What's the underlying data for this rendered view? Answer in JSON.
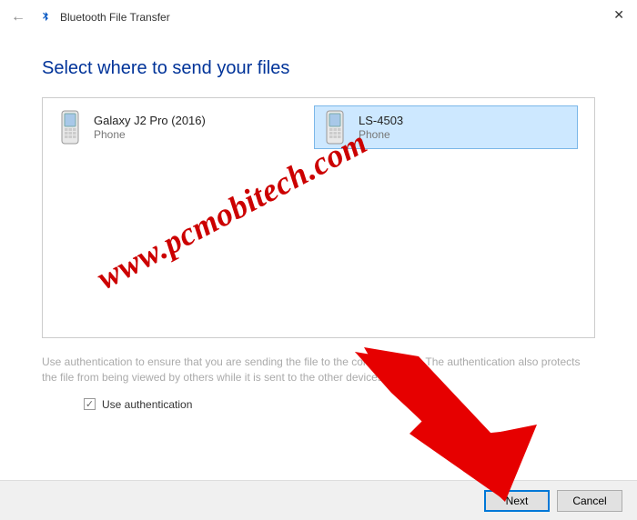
{
  "window": {
    "title": "Bluetooth File Transfer"
  },
  "heading": "Select where to send your files",
  "devices": [
    {
      "name": "Galaxy J2 Pro (2016)",
      "type": "Phone",
      "selected": false
    },
    {
      "name": "LS-4503",
      "type": "Phone",
      "selected": true
    }
  ],
  "help_text": "Use authentication to ensure that you are sending the file to the correct device. The authentication also protects the file from being viewed by others while it is sent to the other devices.",
  "use_auth_label": "Use authentication",
  "use_auth_checked": true,
  "buttons": {
    "next": "Next",
    "cancel": "Cancel"
  },
  "watermark": "www.pcmobitech.com"
}
